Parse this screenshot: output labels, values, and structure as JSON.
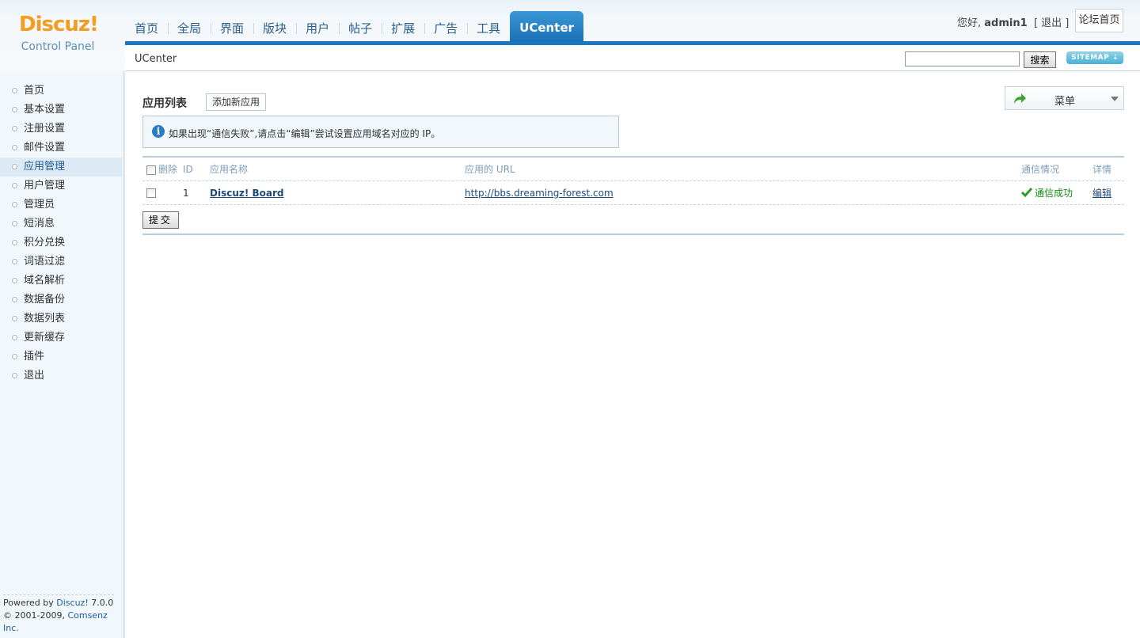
{
  "logo": {
    "brand": "Discuz!",
    "subtitle": "Control Panel"
  },
  "nav": {
    "tabs": [
      {
        "label": "首页"
      },
      {
        "label": "全局"
      },
      {
        "label": "界面"
      },
      {
        "label": "版块"
      },
      {
        "label": "用户"
      },
      {
        "label": "帖子"
      },
      {
        "label": "扩展"
      },
      {
        "label": "广告"
      },
      {
        "label": "工具"
      },
      {
        "label": "UCenter",
        "active": true
      }
    ]
  },
  "user": {
    "greeting": "您好,",
    "name": "admin1",
    "logout": "[ 退出 ]",
    "forum_home": "论坛首页"
  },
  "subbar": {
    "breadcrumb": "UCenter",
    "search_value": "",
    "search_button": "搜索",
    "sitemap": "SITEMAP ⇣"
  },
  "sidebar": {
    "items": [
      {
        "label": "首页"
      },
      {
        "label": "基本设置"
      },
      {
        "label": "注册设置"
      },
      {
        "label": "邮件设置"
      },
      {
        "label": "应用管理",
        "active": true
      },
      {
        "label": "用户管理"
      },
      {
        "label": "管理员"
      },
      {
        "label": "短消息"
      },
      {
        "label": "积分兑换"
      },
      {
        "label": "词语过滤"
      },
      {
        "label": "域名解析"
      },
      {
        "label": "数据备份"
      },
      {
        "label": "数据列表"
      },
      {
        "label": "更新缓存"
      },
      {
        "label": "插件"
      },
      {
        "label": "退出"
      }
    ],
    "footer": {
      "powered_prefix": "Powered by ",
      "powered_link": "Discuz!",
      "version": " 7.0.0",
      "copyright_prefix": "© 2001-2009, ",
      "company": "Comsenz Inc."
    }
  },
  "main": {
    "title": "应用列表",
    "add_button": "添加新应用",
    "menu_label": "菜单",
    "tip": "如果出现“通信失败”,请点击“编辑”尝试设置应用域名对应的 IP。",
    "table": {
      "headers": {
        "delete": "删除",
        "id": "ID",
        "name": "应用名称",
        "url": "应用的 URL",
        "status": "通信情况",
        "detail": "详情"
      },
      "rows": [
        {
          "id": "1",
          "name": "Discuz! Board",
          "url": "http://bbs.dreaming-forest.com",
          "status": "通信成功",
          "detail": "编辑"
        }
      ]
    },
    "submit": "提交"
  }
}
